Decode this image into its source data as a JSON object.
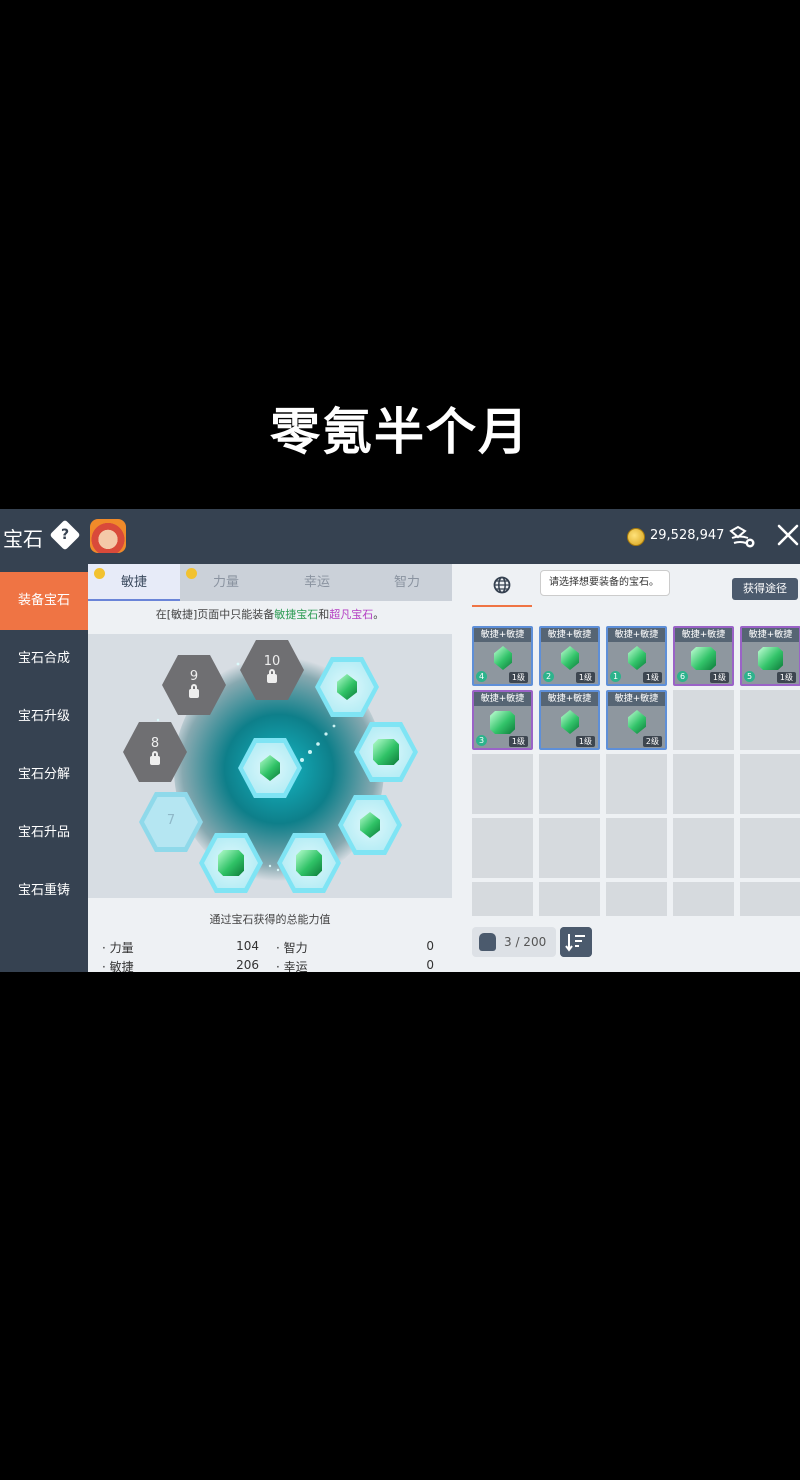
{
  "caption": "零氪半个月",
  "header": {
    "title": "宝石",
    "help_symbol": "?",
    "gold": "29,528,947",
    "icons": [
      "help-icon",
      "avatar",
      "gold-coin-icon",
      "gem-shop-icon",
      "close-icon"
    ]
  },
  "sidebar": {
    "items": [
      {
        "label": "装备宝石",
        "active": true
      },
      {
        "label": "宝石合成"
      },
      {
        "label": "宝石升级"
      },
      {
        "label": "宝石分解"
      },
      {
        "label": "宝石升品"
      },
      {
        "label": "宝石重铸"
      }
    ]
  },
  "tabs": [
    {
      "label": "敏捷",
      "active": true
    },
    {
      "label": "力量"
    },
    {
      "label": "幸运"
    },
    {
      "label": "智力"
    }
  ],
  "notice": {
    "prefix": "在[敏捷]页面中只能装备",
    "green": "敏捷宝石",
    "mid": "和",
    "purple": "超凡宝石",
    "suffix": "。"
  },
  "board": {
    "locked": [
      {
        "num": "9"
      },
      {
        "num": "10"
      },
      {
        "num": "8"
      }
    ],
    "empty": {
      "num": "7"
    }
  },
  "stats": {
    "title": "通过宝石获得的总能力值",
    "rows": [
      {
        "label": "力量",
        "value": "104"
      },
      {
        "label": "智力",
        "value": "0"
      },
      {
        "label": "敏捷",
        "value": "206"
      },
      {
        "label": "幸运",
        "value": "0"
      }
    ]
  },
  "right": {
    "tooltip": "请选择想要装备的宝石。",
    "source_button": "获得途径",
    "bag_count": "3 / 200"
  },
  "inventory": [
    {
      "name": "敏捷+敏捷",
      "count": "4",
      "level": "1级",
      "rarity": "blue"
    },
    {
      "name": "敏捷+敏捷",
      "count": "2",
      "level": "1级",
      "rarity": "blue"
    },
    {
      "name": "敏捷+敏捷",
      "count": "1",
      "level": "1级",
      "rarity": "blue"
    },
    {
      "name": "敏捷+敏捷",
      "count": "6",
      "level": "1级",
      "rarity": "purple"
    },
    {
      "name": "敏捷+敏捷",
      "count": "5",
      "level": "1级",
      "rarity": "purple"
    },
    {
      "name": "敏捷+敏捷",
      "count": "3",
      "level": "1级",
      "rarity": "purple"
    },
    {
      "name": "敏捷+敏捷",
      "count": "",
      "level": "1级",
      "rarity": "blue"
    },
    {
      "name": "敏捷+敏捷",
      "count": "",
      "level": "2级",
      "rarity": "blue"
    }
  ]
}
